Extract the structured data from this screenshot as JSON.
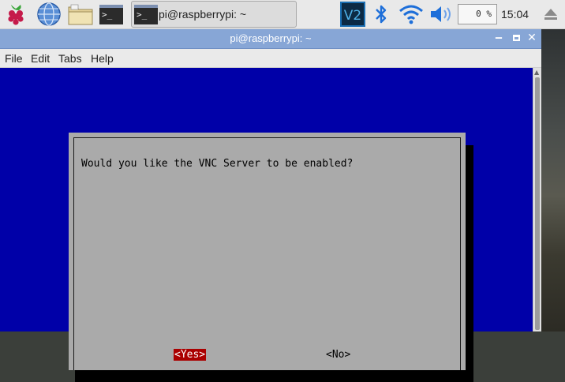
{
  "panel": {
    "task_label": "pi@raspberrypi: ~",
    "vnc_icon_text": "V2",
    "cpu_usage": "0 %",
    "clock": "15:04",
    "icons": [
      "raspberry-menu-icon",
      "web-browser-icon",
      "file-manager-icon",
      "terminal-icon",
      "vnc-icon",
      "bluetooth-icon",
      "wifi-icon",
      "volume-icon",
      "eject-icon"
    ]
  },
  "window": {
    "title": "pi@raspberrypi: ~",
    "controls": {
      "minimize": "‒",
      "maximize": "▫",
      "close": "✕"
    },
    "menu": [
      "File",
      "Edit",
      "Tabs",
      "Help"
    ]
  },
  "dialog": {
    "question": "Would you like the VNC Server to be enabled?",
    "yes_label": "<Yes>",
    "no_label": "<No>"
  },
  "colors": {
    "terminal_bg": "#0000a8",
    "dialog_bg": "#aaaaaa",
    "selected_button": "#aa0000",
    "titlebar": "#87a6d6",
    "vnc_accent": "#1b6fb3",
    "bluetooth": "#1e6fd9"
  }
}
